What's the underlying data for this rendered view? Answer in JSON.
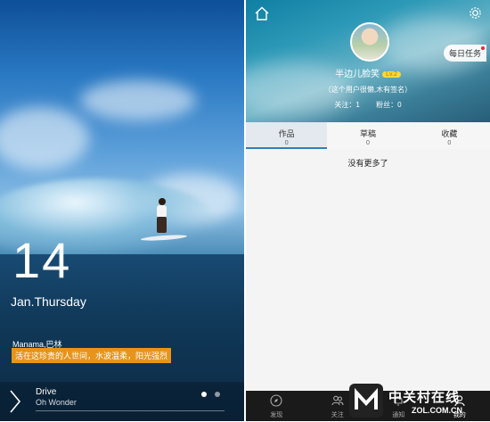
{
  "lockscreen": {
    "day": "14",
    "date": "Jan.Thursday",
    "location": "Manama,巴林",
    "quote": "活在这珍贵的人世间，水波温柔，阳光强烈",
    "music": {
      "title": "Drive",
      "artist": "Oh Wonder"
    }
  },
  "profile": {
    "daily_task": "每日任务",
    "username": "半边儿脸笑",
    "level": "Lv.2",
    "bio": "（这个用户很懒,木有签名）",
    "following_label": "关注：1",
    "followers_label": "粉丝：0",
    "tabs": [
      {
        "label": "作品",
        "count": "0"
      },
      {
        "label": "草稿",
        "count": "0"
      },
      {
        "label": "收藏",
        "count": "0"
      }
    ],
    "empty_text": "没有更多了"
  },
  "bottom_nav": [
    {
      "label": "发现",
      "icon": "compass-icon"
    },
    {
      "label": "关注",
      "icon": "people-icon"
    },
    {
      "label": "通知",
      "icon": "bell-icon"
    },
    {
      "label": "我的",
      "icon": "user-icon"
    }
  ],
  "watermark": {
    "line1": "中关村在线",
    "line2": "ZOL.COM.CN"
  },
  "colors": {
    "quote_bg": "#e8941b",
    "tab_accent": "#2f7fbe",
    "level_badge": "#f7d93a"
  }
}
